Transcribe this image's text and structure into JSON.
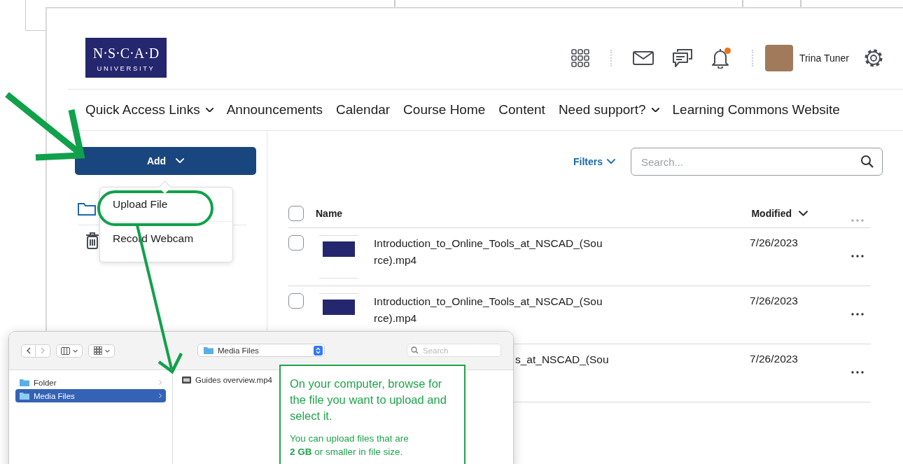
{
  "header": {
    "logo": {
      "line1": "N·S·C·A·D",
      "line2": "UNIVERSITY"
    },
    "notifications_unread": true,
    "user": {
      "name": "Trina Tuner"
    }
  },
  "nav": {
    "items": [
      {
        "label": "Quick Access Links",
        "dropdown": true
      },
      {
        "label": "Announcements",
        "dropdown": false
      },
      {
        "label": "Calendar",
        "dropdown": false
      },
      {
        "label": "Course Home",
        "dropdown": false
      },
      {
        "label": "Content",
        "dropdown": false
      },
      {
        "label": "Need support?",
        "dropdown": true
      },
      {
        "label": "Learning Commons Website",
        "dropdown": false
      }
    ]
  },
  "add_button": {
    "label": "Add"
  },
  "add_menu": {
    "items": [
      {
        "label": "Upload File",
        "circled": true
      },
      {
        "label": "Record Webcam",
        "circled": false
      }
    ]
  },
  "filters": {
    "label": "Filters"
  },
  "search": {
    "placeholder": "Search..."
  },
  "table": {
    "header_checked": false,
    "columns": [
      {
        "label": "Name"
      },
      {
        "label": "Modified",
        "sorted": true
      }
    ],
    "rows": [
      {
        "checked": false,
        "name_lines": [
          "Introduction_to_Online_Tools_at_NSCAD_(Sou",
          "rce).mp4"
        ],
        "modified": "7/26/2023"
      },
      {
        "checked": false,
        "name_lines": [
          "Introduction_to_Online_Tools_at_NSCAD_(Sou",
          "rce).mp4"
        ],
        "modified": "7/26/2023"
      }
    ],
    "partial_row": {
      "name": "s_at_NSCAD_(Sou",
      "modified": "7/26/2023"
    }
  },
  "file_dialog": {
    "location": "Media Files",
    "search_placeholder": "Search",
    "sidebar": [
      {
        "label": "Folder",
        "selected": false
      },
      {
        "label": "Media Files",
        "selected": true
      }
    ],
    "files": [
      {
        "name": "Guides overview.mp4"
      }
    ]
  },
  "callout": {
    "heading": "On your computer, browse for the file you want to upload and select it.",
    "note": "You can upload files that are **2 GB** or smaller in file size."
  }
}
